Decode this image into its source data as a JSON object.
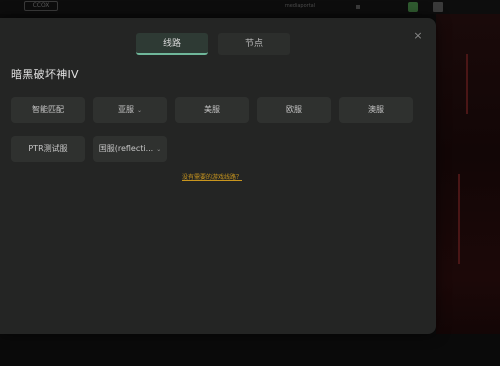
{
  "background": {
    "logo_text": "CCOX",
    "title_text": "mediaportal"
  },
  "modal": {
    "tabs": [
      {
        "label": "线路",
        "active": true
      },
      {
        "label": "节点",
        "active": false
      }
    ],
    "close_icon": "×",
    "show_title": "暗黑破坏神IV",
    "routes": [
      {
        "label": "智能匹配"
      },
      {
        "label": "亚服",
        "has_dropdown": true
      },
      {
        "label": "美服"
      },
      {
        "label": "欧服"
      },
      {
        "label": "澳服"
      },
      {
        "label": "PTR测试服"
      },
      {
        "label": "国服(reflecti...",
        "has_dropdown": true
      }
    ],
    "dropdown_glyph": "⌄",
    "feedback_link": "没有需要的游戏线路？"
  },
  "colors": {
    "modal_bg": "#242524",
    "chip_bg": "#2f312f",
    "tab_active_underline": "#6fb79a",
    "link_color": "#c9961e"
  }
}
